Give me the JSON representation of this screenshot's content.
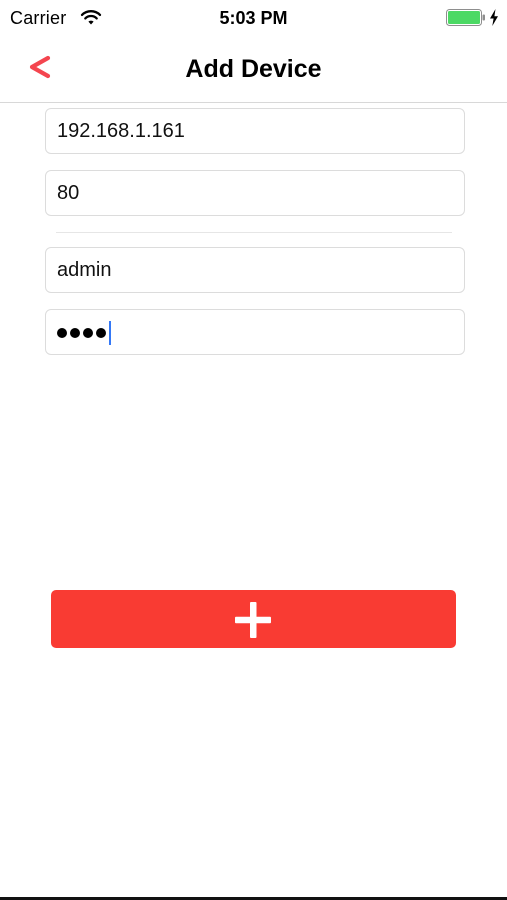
{
  "status_bar": {
    "carrier": "Carrier",
    "time": "5:03 PM",
    "battery_color": "#4cd964",
    "icons": [
      "wifi-icon",
      "battery-icon",
      "charging-bolt-icon"
    ]
  },
  "nav": {
    "title": "Add Device",
    "back_icon": "chevron-left-icon",
    "accent_color": "#f4454f"
  },
  "form": {
    "ip_address": "192.168.1.161",
    "port": "80",
    "username": "admin",
    "password_mask_length": 4,
    "password_focused": true
  },
  "add_button": {
    "icon": "plus-icon",
    "color": "#f93b33"
  }
}
